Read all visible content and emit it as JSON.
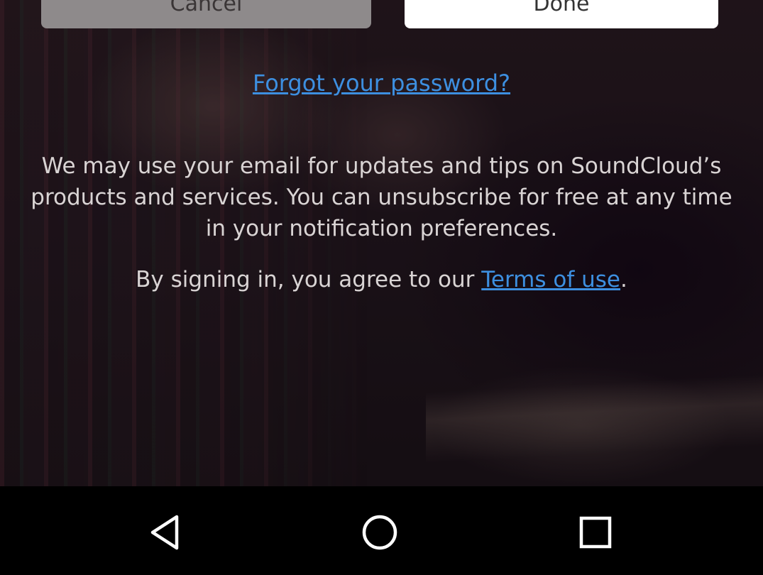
{
  "dialog": {
    "cancel_label": "Cancel",
    "done_label": "Done"
  },
  "links": {
    "forgot_password": "Forgot your password?"
  },
  "notice": {
    "email_text": "We may use your email for updates and tips on SoundCloud’s products and services. You can unsubscribe for free at any time in your notification preferences.",
    "terms_prefix": "By signing in, you agree to our ",
    "terms_link": "Terms of use",
    "terms_suffix": "."
  },
  "nav_bar": {
    "back_icon": "back-triangle-icon",
    "home_icon": "home-circle-icon",
    "recents_icon": "recents-square-icon"
  },
  "colors": {
    "link": "#3d8fe0",
    "text": "#d9d4d4",
    "nav_bar": "#000000"
  }
}
